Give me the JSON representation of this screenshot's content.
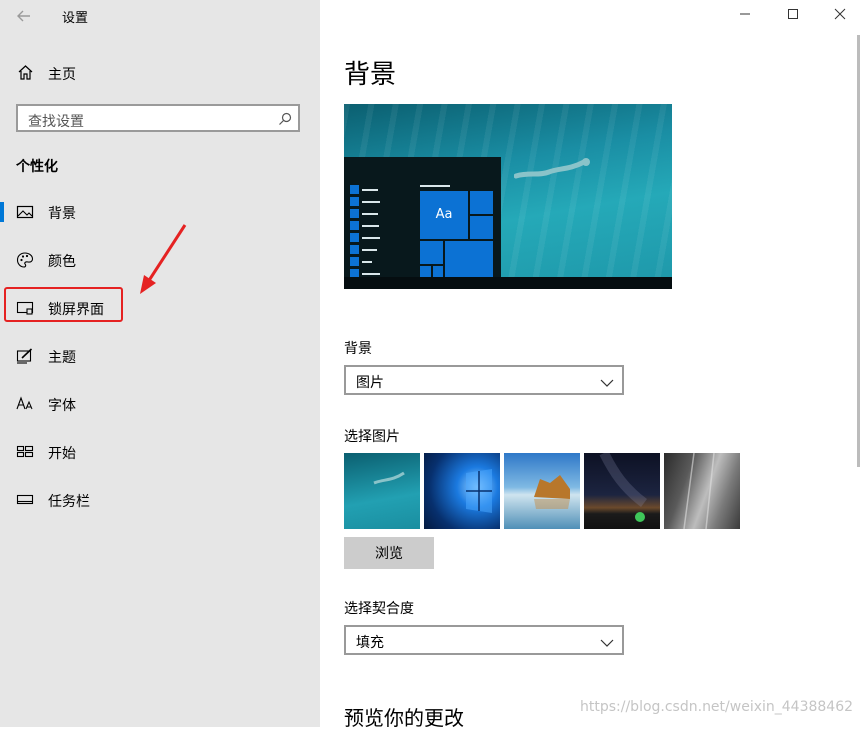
{
  "window": {
    "title": "设置",
    "controls": [
      "minimize-icon",
      "maximize-icon",
      "close-icon"
    ]
  },
  "sidebar": {
    "home_label": "主页",
    "search_placeholder": "查找设置",
    "section_title": "个性化",
    "items": [
      {
        "label": "背景",
        "icon": "picture-icon",
        "active": true
      },
      {
        "label": "颜色",
        "icon": "palette-icon",
        "active": false
      },
      {
        "label": "锁屏界面",
        "icon": "lock-screen-icon",
        "active": false
      },
      {
        "label": "主题",
        "icon": "theme-brush-icon",
        "active": false
      },
      {
        "label": "字体",
        "icon": "font-icon",
        "active": false
      },
      {
        "label": "开始",
        "icon": "start-grid-icon",
        "active": false
      },
      {
        "label": "任务栏",
        "icon": "taskbar-icon",
        "active": false
      }
    ]
  },
  "main": {
    "title": "背景",
    "preview_tile_text": "Aa",
    "background": {
      "label": "背景",
      "value": "图片"
    },
    "choose_picture": {
      "label": "选择图片",
      "browse_label": "浏览"
    },
    "fit": {
      "label": "选择契合度",
      "value": "填充"
    },
    "preview_heading": "预览你的更改"
  },
  "watermark": "https://blog.csdn.net/weixin_44388462",
  "colors": {
    "accent": "#0078d7",
    "annotation": "#e52222",
    "sidebar_bg": "#e6e6e6"
  }
}
